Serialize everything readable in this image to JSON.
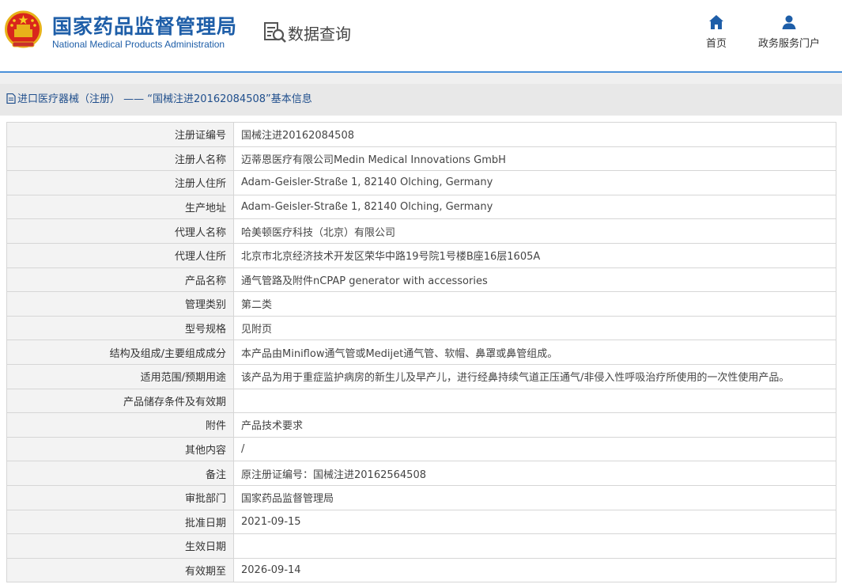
{
  "header": {
    "org_name_cn": "国家药品监督管理局",
    "org_name_en": "National Medical Products Administration",
    "section_title": "数据查询",
    "nav": [
      {
        "label": "首页",
        "icon": "home-icon"
      },
      {
        "label": "政务服务门户",
        "icon": "user-icon"
      }
    ]
  },
  "colors": {
    "brand_blue": "#1e5ea8",
    "divider_blue": "#4a90d9",
    "breadcrumb_bg": "#e8e8e8",
    "label_bg": "#f3f3f3"
  },
  "breadcrumb": {
    "category": "进口医疗器械（注册）",
    "separator": "——",
    "current": "“国械注进20162084508”基本信息"
  },
  "details": [
    {
      "label": "注册证编号",
      "value": "国械注进20162084508"
    },
    {
      "label": "注册人名称",
      "value": "迈蒂恩医疗有限公司Medin Medical Innovations GmbH"
    },
    {
      "label": "注册人住所",
      "value": "Adam-Geisler-Straße 1, 82140 Olching, Germany"
    },
    {
      "label": "生产地址",
      "value": "Adam-Geisler-Straße 1, 82140 Olching, Germany"
    },
    {
      "label": "代理人名称",
      "value": "哈美顿医疗科技（北京）有限公司"
    },
    {
      "label": "代理人住所",
      "value": "北京市北京经济技术开发区荣华中路19号院1号楼B座16层1605A"
    },
    {
      "label": "产品名称",
      "value": "通气管路及附件nCPAP generator with accessories"
    },
    {
      "label": "管理类别",
      "value": "第二类"
    },
    {
      "label": "型号规格",
      "value": "见附页"
    },
    {
      "label": "结构及组成/主要组成成分",
      "value": "本产品由Miniflow通气管或Medijet通气管、软帽、鼻罩或鼻管组成。"
    },
    {
      "label": "适用范围/预期用途",
      "value": "该产品为用于重症监护病房的新生儿及早产儿，进行经鼻持续气道正压通气/非侵入性呼吸治疗所使用的一次性使用产品。"
    },
    {
      "label": "产品储存条件及有效期",
      "value": ""
    },
    {
      "label": "附件",
      "value": "产品技术要求"
    },
    {
      "label": "其他内容",
      "value": "/"
    },
    {
      "label": "备注",
      "value": "原注册证编号：国械注进20162564508"
    },
    {
      "label": "审批部门",
      "value": "国家药品监督管理局"
    },
    {
      "label": "批准日期",
      "value": "2021-09-15"
    },
    {
      "label": "生效日期",
      "value": ""
    },
    {
      "label": "有效期至",
      "value": "2026-09-14"
    }
  ]
}
